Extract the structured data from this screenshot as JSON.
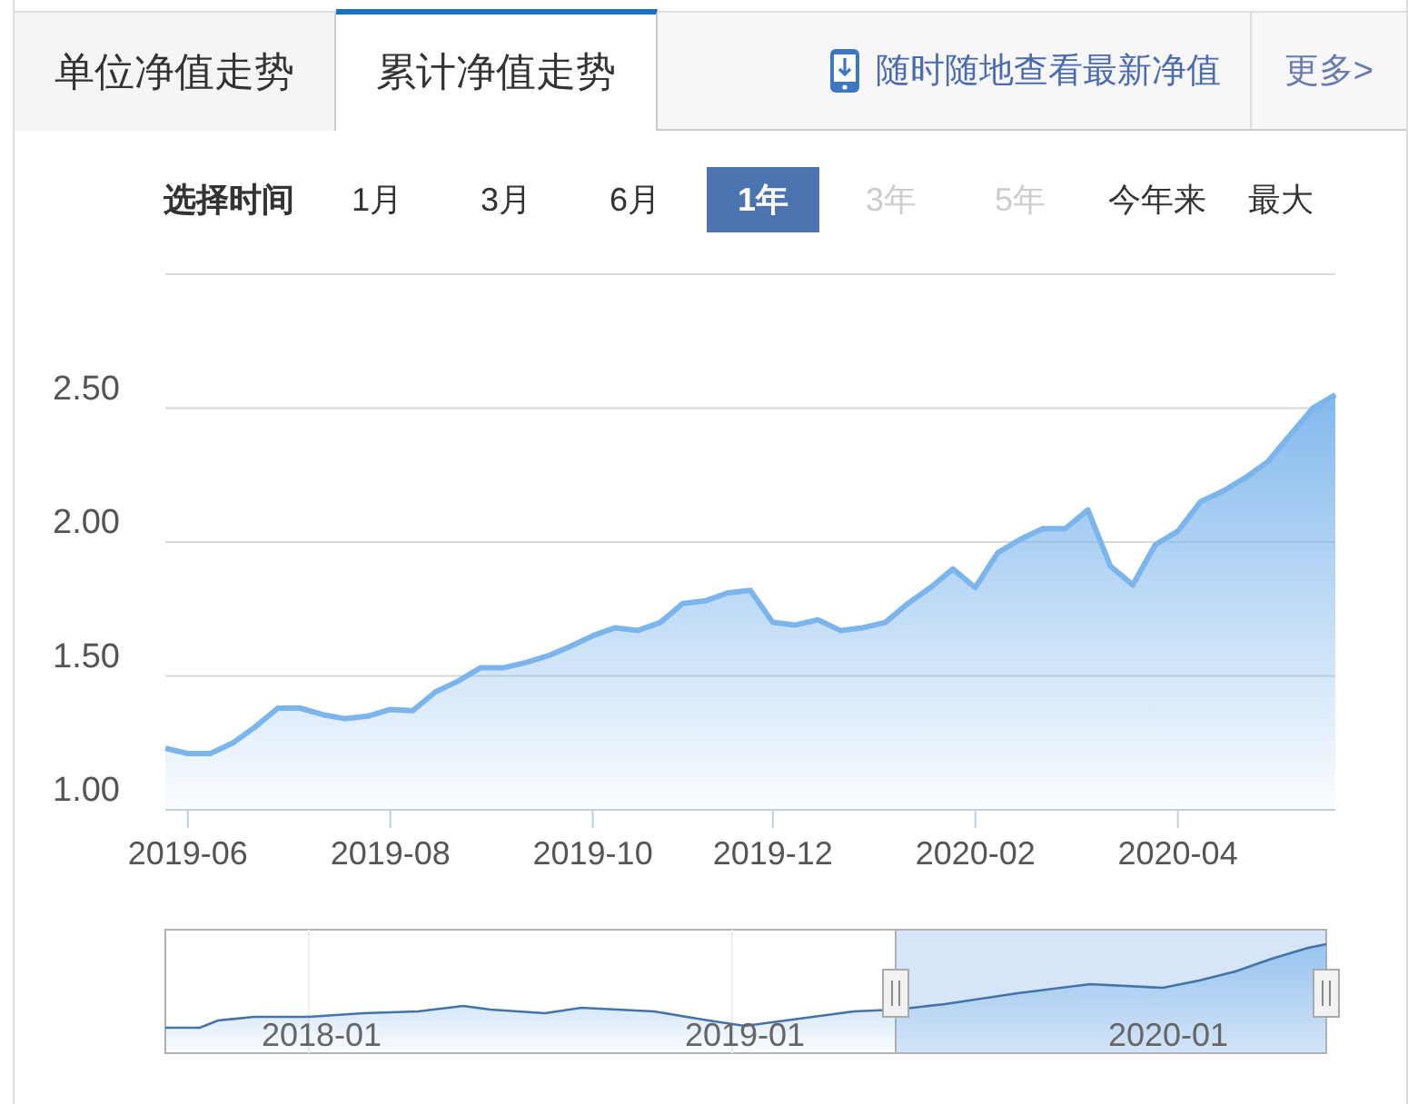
{
  "tabs": [
    {
      "label": "单位净值走势",
      "selected": false
    },
    {
      "label": "累计净值走势",
      "selected": true
    }
  ],
  "app_link": {
    "label": "随时随地查看最新净值"
  },
  "more_link": {
    "label": "更多>"
  },
  "time_range": {
    "label": "选择时间",
    "options": [
      {
        "label": "1月",
        "selected": false,
        "disabled": false
      },
      {
        "label": "3月",
        "selected": false,
        "disabled": false
      },
      {
        "label": "6月",
        "selected": false,
        "disabled": false
      },
      {
        "label": "1年",
        "selected": true,
        "disabled": false
      },
      {
        "label": "3年",
        "selected": false,
        "disabled": true
      },
      {
        "label": "5年",
        "selected": false,
        "disabled": true
      },
      {
        "label": "今年来",
        "selected": false,
        "disabled": false
      },
      {
        "label": "最大",
        "selected": false,
        "disabled": false
      }
    ]
  },
  "chart": {
    "chart_data": {
      "type": "area",
      "categories": [
        null,
        "2019-06",
        null,
        null,
        null,
        null,
        null,
        null,
        null,
        null,
        "2019-08",
        null,
        null,
        null,
        null,
        null,
        null,
        null,
        null,
        "2019-10",
        null,
        null,
        null,
        null,
        null,
        null,
        null,
        "2019-12",
        null,
        null,
        null,
        null,
        null,
        null,
        null,
        null,
        "2020-02",
        null,
        null,
        null,
        null,
        null,
        null,
        null,
        null,
        "2020-04",
        null,
        null,
        null,
        null,
        null,
        null,
        null
      ],
      "series": [
        {
          "color": "#7cb5ec",
          "values": [
            1.23,
            1.21,
            1.21,
            1.25,
            1.31,
            1.38,
            1.38,
            1.355,
            1.34,
            1.35,
            1.375,
            1.37,
            1.44,
            1.48,
            1.53,
            1.53,
            1.55,
            1.575,
            1.61,
            1.65,
            1.68,
            1.67,
            1.7,
            1.77,
            1.78,
            1.81,
            1.82,
            1.7,
            1.69,
            1.71,
            1.67,
            1.68,
            1.7,
            1.77,
            1.83,
            1.9,
            1.83,
            1.96,
            2.01,
            2.05,
            2.05,
            2.12,
            1.91,
            1.84,
            1.99,
            2.04,
            2.15,
            2.19,
            2.24,
            2.3,
            2.4,
            2.5,
            2.55
          ]
        }
      ],
      "ylim": [
        1,
        3
      ],
      "grid": true,
      "yticks": [
        {
          "value": 1,
          "label": "1.00"
        },
        {
          "value": 1.5,
          "label": "1.50"
        },
        {
          "value": 2,
          "label": "2.00"
        },
        {
          "value": 2.5,
          "label": "2.50"
        }
      ]
    }
  },
  "navigator": {
    "labels": [
      "2018-01",
      "2019-01",
      "2020-01"
    ]
  }
}
